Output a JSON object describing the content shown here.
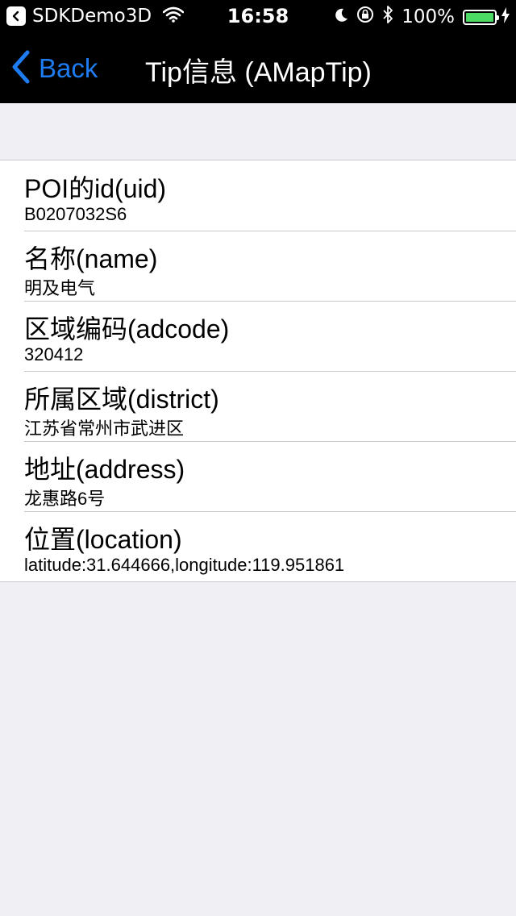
{
  "status_bar": {
    "app_name": "SDKDemo3D",
    "time": "16:58",
    "battery_percent": "100%",
    "battery_level": 1.0
  },
  "nav": {
    "back_label": "Back",
    "title": "Tip信息 (AMapTip)"
  },
  "rows": [
    {
      "title": "POI的id(uid)",
      "value": "B0207032S6"
    },
    {
      "title": "名称(name)",
      "value": "明及电气"
    },
    {
      "title": "区域编码(adcode)",
      "value": "320412"
    },
    {
      "title": "所属区域(district)",
      "value": "江苏省常州市武进区"
    },
    {
      "title": "地址(address)",
      "value": "龙惠路6号"
    },
    {
      "title": "位置(location)",
      "value": "latitude:31.644666,longitude:119.951861"
    }
  ],
  "colors": {
    "accent": "#1e7cf2",
    "battery": "#4cd964",
    "background": "#efeff4"
  }
}
